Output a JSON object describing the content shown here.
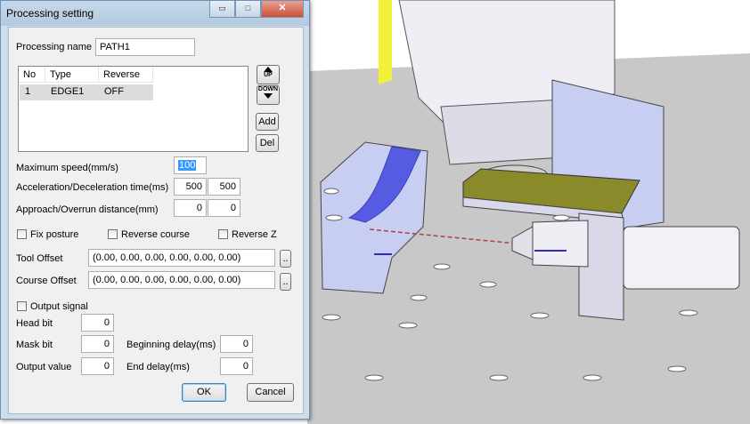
{
  "window": {
    "title": "Processing setting",
    "minimize_glyph": "▭",
    "maximize_glyph": "□",
    "close_glyph": "✕"
  },
  "processing_name": {
    "label": "Processing name",
    "value": "PATH1"
  },
  "path_list": {
    "columns": [
      "No",
      "Type",
      "Reverse"
    ],
    "rows": [
      {
        "no": "1",
        "type": "EDGE1",
        "reverse": "OFF"
      }
    ]
  },
  "side_buttons": {
    "up": "UP",
    "down": "DOWN",
    "add": "Add",
    "del": "Del"
  },
  "max_speed": {
    "label": "Maximum speed(mm/s)",
    "value": "100"
  },
  "accel": {
    "label": "Acceleration/Deceleration time(ms)",
    "value1": "500",
    "value2": "500"
  },
  "approach": {
    "label": "Approach/Overrun distance(mm)",
    "value1": "0",
    "value2": "0"
  },
  "checks": {
    "fix_posture": "Fix posture",
    "reverse_course": "Reverse course",
    "reverse_z": "Reverse Z",
    "output_signal": "Output signal"
  },
  "tool_offset": {
    "label": "Tool Offset",
    "value": "(0.00, 0.00, 0.00, 0.00, 0.00, 0.00)",
    "browse": ".."
  },
  "course_offset": {
    "label": "Course Offset",
    "value": "(0.00, 0.00, 0.00, 0.00, 0.00, 0.00)",
    "browse": ".."
  },
  "head_bit": {
    "label": "Head bit",
    "value": "0"
  },
  "mask_bit": {
    "label": "Mask bit",
    "value": "0"
  },
  "output_value": {
    "label": "Output value",
    "value": "0"
  },
  "beginning_delay": {
    "label": "Beginning delay(ms)",
    "value": "0"
  },
  "end_delay": {
    "label": "End delay(ms)",
    "value": "0"
  },
  "footer": {
    "ok": "OK",
    "cancel": "Cancel"
  },
  "colors": {
    "background_plane": "#c9c9c9",
    "fixture_blue": "#c8cdf2",
    "path_blue": "#4a50e0",
    "tool_holder": "#8a8a2a",
    "guard_yellow": "#f3f03a"
  }
}
